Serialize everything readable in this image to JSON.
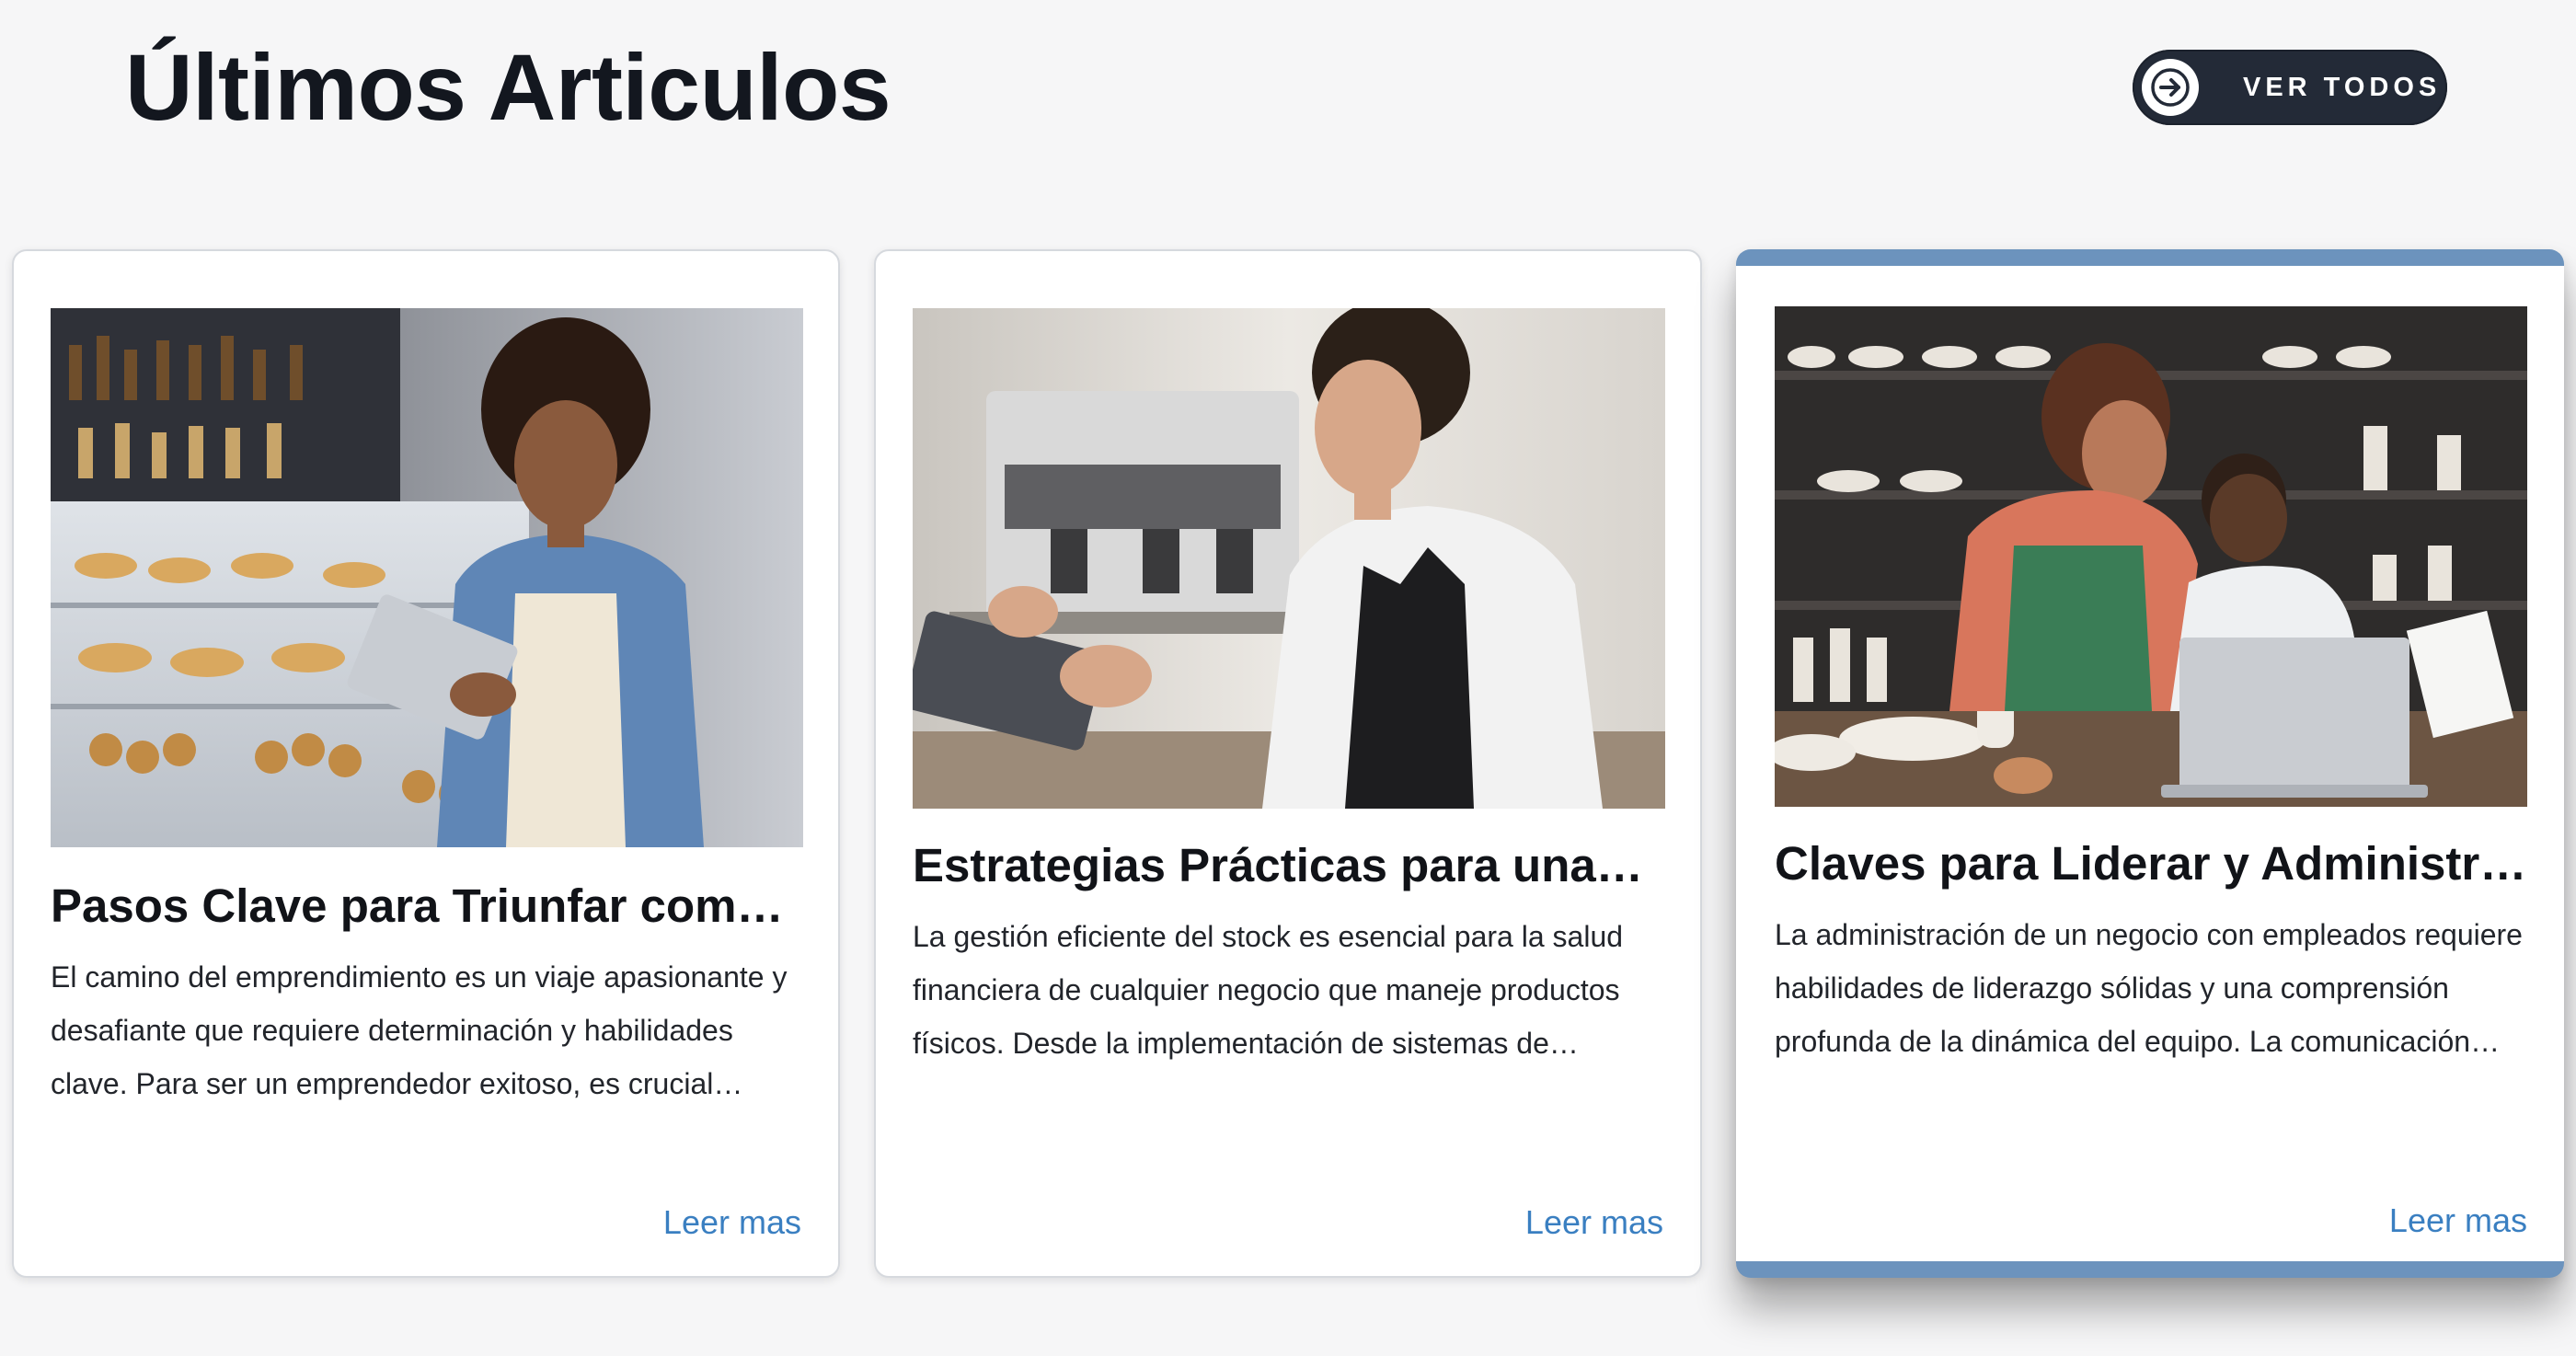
{
  "header": {
    "title": "Últimos Articulos",
    "view_all_label": "VER TODOS"
  },
  "cards": [
    {
      "title": "Pasos Clave para Triunfar como…",
      "excerpt": "El camino del emprendimiento es un viaje apasionante y desafiante que requiere determinación y habilidades clave. Para ser un emprendedor exitoso, es crucial…",
      "read_more": "Leer mas",
      "image": "shop-owner-woman-with-tablet-at-pastry-counter"
    },
    {
      "title": "Estrategias Prácticas para una…",
      "excerpt": "La gestión eficiente del stock es esencial para la salud financiera de cualquier negocio que maneje productos físicos. Desde la implementación de sistemas de…",
      "read_more": "Leer mas",
      "image": "barista-woman-using-tablet-at-coffee-machine"
    },
    {
      "title": "Claves para Liderar y Administrar …",
      "excerpt": "La administración de un negocio con empleados requiere habilidades de liderazgo sólidas y una comprensión profunda de la dinámica del equipo. La comunicación…",
      "read_more": "Leer mas",
      "image": "two-ceramic-shop-workers-with-laptop-and-phone"
    }
  ],
  "colors": {
    "page_background": "#f6f6f7",
    "title": "#13171f",
    "button_background": "#232a37",
    "link": "#3a7fc1",
    "active_card_accent": "#6c93bd"
  }
}
